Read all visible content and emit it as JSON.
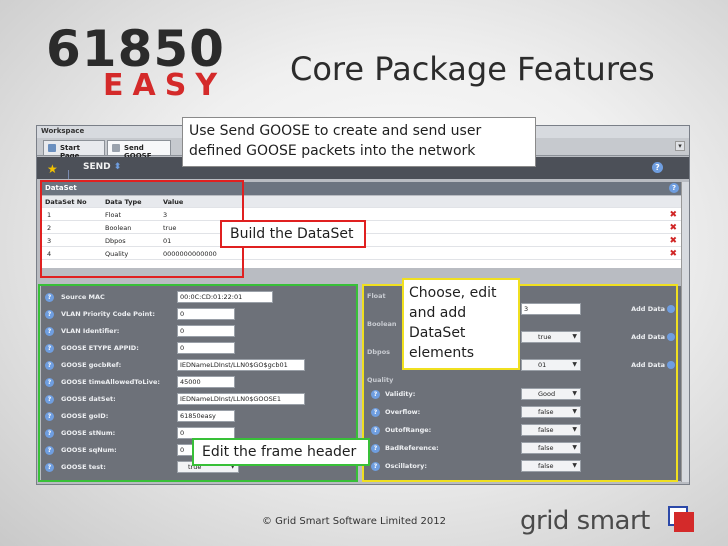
{
  "slide": {
    "logo_top": "61850",
    "logo_bottom": "EASY",
    "title": "Core Package Features",
    "footer": "© Grid Smart Software Limited 2012",
    "brand": "grid smart"
  },
  "callouts": {
    "goose": "Use Send GOOSE to create and send user defined GOOSE packets into the network",
    "dataset": "Build the DataSet",
    "choose": "Choose, edit and add DataSet elements",
    "frame": "Edit the frame header"
  },
  "app": {
    "workspace_label": "Workspace",
    "tabs": [
      {
        "label": "Start Page"
      },
      {
        "label": "Send GOOSE"
      }
    ],
    "toolbar": {
      "send_label": "SEND"
    },
    "dataset": {
      "title": "DataSet",
      "columns": [
        "DataSet No",
        "Data Type",
        "Value"
      ],
      "rows": [
        {
          "no": "1",
          "type": "Float",
          "value": "3"
        },
        {
          "no": "2",
          "type": "Boolean",
          "value": "true"
        },
        {
          "no": "3",
          "type": "Dbpos",
          "value": "01"
        },
        {
          "no": "4",
          "type": "Quality",
          "value": "0000000000000"
        }
      ]
    },
    "header_fields": [
      {
        "label": "Source MAC",
        "value": "00:0C:CD:01:22:01"
      },
      {
        "label": "VLAN Priority Code Point:",
        "value": "0"
      },
      {
        "label": "VLAN Identifier:",
        "value": "0"
      },
      {
        "label": "GOOSE ETYPE APPID:",
        "value": "0"
      },
      {
        "label": "GOOSE gocbRef:",
        "value": "IEDNameLDInst/LLN0$GO$gcb01"
      },
      {
        "label": "GOOSE timeAllowedToLive:",
        "value": "45000"
      },
      {
        "label": "GOOSE datSet:",
        "value": "IEDNameLDInst/LLN0$GOOSE1"
      },
      {
        "label": "GOOSE goID:",
        "value": "61850easy"
      },
      {
        "label": "GOOSE stNum:",
        "value": "0"
      },
      {
        "label": "GOOSE sqNum:",
        "value": "0"
      },
      {
        "label": "GOOSE test:",
        "value": "true"
      }
    ],
    "elements": {
      "float_label": "Float",
      "float_value": "3",
      "boolean_label": "Boolean",
      "boolean_value": "true",
      "dbpos_label": "Dbpos",
      "dbpos_value": "01",
      "quality_label": "Quality",
      "add_data": "Add Data",
      "quality_fields": [
        {
          "label": "Validity:",
          "value": "Good"
        },
        {
          "label": "Overflow:",
          "value": "false"
        },
        {
          "label": "OutofRange:",
          "value": "false"
        },
        {
          "label": "BadReference:",
          "value": "false"
        },
        {
          "label": "Oscillatory:",
          "value": "false"
        }
      ]
    }
  }
}
